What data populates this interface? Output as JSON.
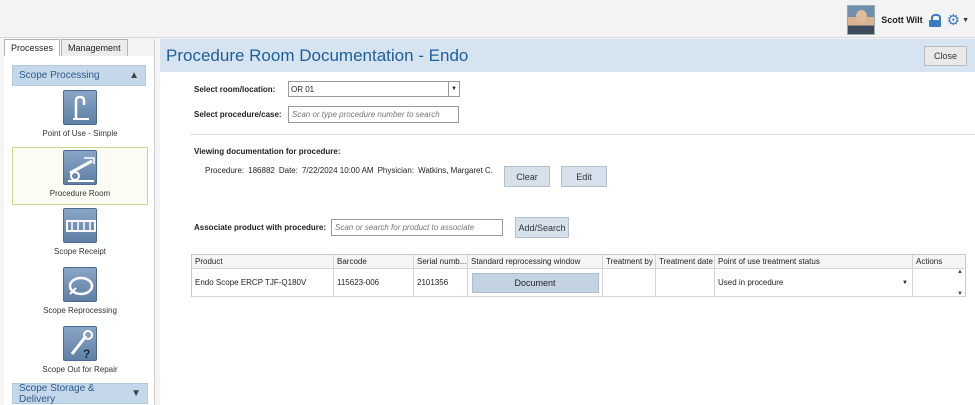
{
  "user": {
    "name": "Scott Wilt"
  },
  "left_tabs": [
    "Processes",
    "Management"
  ],
  "sidebar": {
    "section_top": "Scope Processing",
    "items": [
      {
        "label": "Point of Use - Simple"
      },
      {
        "label": "Procedure Room"
      },
      {
        "label": "Scope Receipt"
      },
      {
        "label": "Scope Reprocessing"
      },
      {
        "label": "Scope Out for Repair"
      }
    ],
    "section_bottom": "Scope Storage & Delivery"
  },
  "main": {
    "title": "Procedure Room Documentation - Endo",
    "close_label": "Close",
    "room_label": "Select room/location:",
    "room_value": "OR 01",
    "procedure_label": "Select procedure/case:",
    "procedure_placeholder": "Scan or type procedure number to search",
    "viewing_label": "Viewing documentation for procedure:",
    "procedure_line": {
      "procedure_key": "Procedure:",
      "procedure_val": "186882",
      "date_key": "Date:",
      "date_val": "7/22/2024 10:00 AM",
      "physician_key": "Physician:",
      "physician_val": "Watkins, Margaret C."
    },
    "clear_label": "Clear",
    "edit_label": "Edit",
    "associate_label": "Associate product with procedure:",
    "associate_placeholder": "Scan or search for product to associate",
    "add_search_label": "Add/Search"
  },
  "table": {
    "columns": [
      "Product",
      "Barcode",
      "Serial numb...",
      "Standard reprocessing window",
      "Treatment by",
      "Treatment date",
      "Point of use treatment status",
      "Actions"
    ],
    "rows": [
      {
        "product": "Endo Scope ERCP TJF-Q180V",
        "barcode": "115623-006",
        "serial": "2101356",
        "window_button": "Document",
        "treatment_by": "",
        "treatment_date": "",
        "status": "Used in procedure",
        "actions": ""
      }
    ]
  },
  "colors": {
    "accent": "#1f5d99",
    "title_bar": "#d6e4f1",
    "section": "#c5d7ea"
  }
}
